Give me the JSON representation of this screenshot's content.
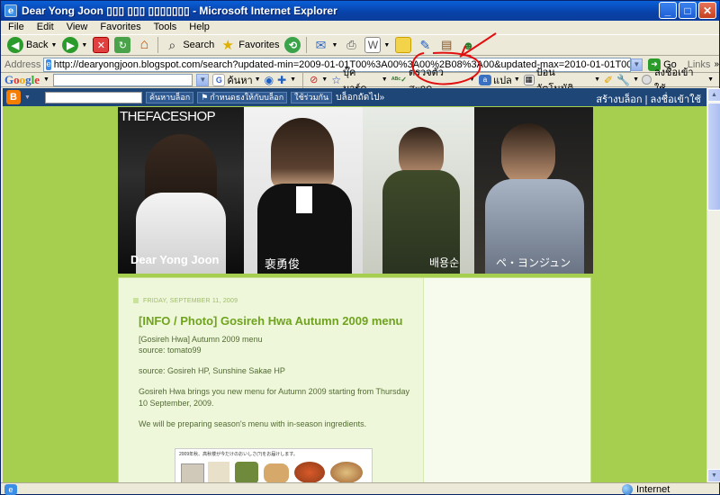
{
  "window": {
    "title": "Dear Yong Joon ▯▯▯ ▯▯▯ ▯▯▯▯▯▯▯ - Microsoft Internet Explorer"
  },
  "menu": [
    "File",
    "Edit",
    "View",
    "Favorites",
    "Tools",
    "Help"
  ],
  "toolbar": {
    "back": "Back",
    "search": "Search",
    "favorites": "Favorites"
  },
  "address": {
    "label": "Address",
    "url": "http://dearyongjoon.blogspot.com/search?updated-min=2009-01-01T00%3A00%3A00%2B08%3A00&updated-max=2010-01-01T00%3A00%3A00%2B08%3A00&max-results=50",
    "go": "Go",
    "links": "Links"
  },
  "google_toolbar": {
    "logo": "Google",
    "search_btn": "ค้นหา",
    "bookmarks": "บุ๊คมาร์ค",
    "spellcheck": "ตรวจตัวสะกด",
    "translate": "แปล",
    "autofill": "ป้อนอัตโนมัติ",
    "signin": "ลงชื่อเข้าใช้"
  },
  "blogger_bar": {
    "search_blog": "ค้นหาบล็อก",
    "flag": "กำหนดธงให้กับบล็อก",
    "share": "ใช้ร่วมกัน",
    "next_blog": "บล็อกถัดไป»",
    "create": "สร้างบล็อก",
    "login": "ลงชื่อเข้าใช้"
  },
  "header": {
    "brand": "THEFACESHOP",
    "name_en": "Dear Yong Joon",
    "name_cn": "裵勇俊",
    "name_kr": "배용순",
    "name_jp": "ペ・ヨンジュン"
  },
  "post": {
    "date": "FRIDAY, SEPTEMBER 11, 2009",
    "title": "[INFO / Photo] Gosireh Hwa Autumn 2009 menu",
    "lines": [
      "[Gosireh Hwa] Autumn 2009 menu",
      "source: tomato99",
      "source: Gosireh HP, Sunshine Sakae HP",
      "Gosireh Hwa brings you new menu for Autumn 2009 starting from Thursday 10 September, 2009.",
      "We will be preparing season's menu with in-season ingredients."
    ],
    "image_caption": "2009年秋、高秋楼が今だけのおいしさ(?)をお届けします。"
  },
  "status": {
    "zone": "Internet"
  },
  "colors": {
    "page_bg": "#a6cf50",
    "post_title": "#6fa31e",
    "blogger_bar": "#1e4677",
    "annotation": "#e01010"
  }
}
